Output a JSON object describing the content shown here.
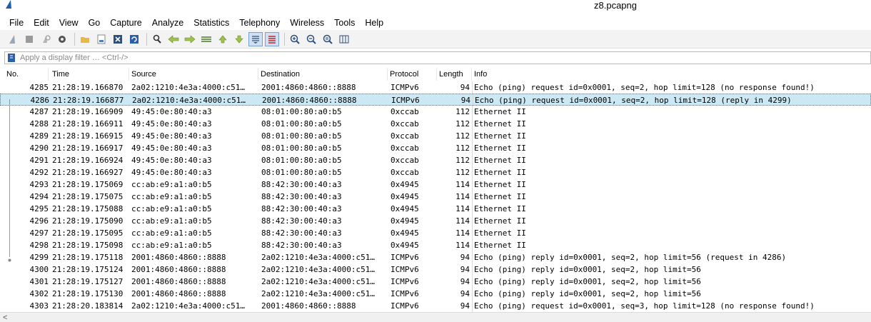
{
  "window": {
    "title": "z8.pcapng"
  },
  "menu": [
    "File",
    "Edit",
    "View",
    "Go",
    "Capture",
    "Analyze",
    "Statistics",
    "Telephony",
    "Wireless",
    "Tools",
    "Help"
  ],
  "toolbar": {
    "icons": [
      "shark-fin-start-icon",
      "stop-icon",
      "restart-icon",
      "options-gear-icon",
      "open-folder-icon",
      "save-file-icon",
      "close-file-icon",
      "reload-icon",
      "find-icon",
      "back-arrow-icon",
      "forward-arrow-icon",
      "goto-packet-icon",
      "first-packet-icon",
      "last-packet-icon",
      "autoscroll-icon",
      "colorize-icon",
      "zoom-in-icon",
      "zoom-out-icon",
      "zoom-normal-icon",
      "resize-columns-icon"
    ]
  },
  "filter": {
    "placeholder": "Apply a display filter … <Ctrl-/>"
  },
  "columns": {
    "no": "No.",
    "time": "Time",
    "source": "Source",
    "destination": "Destination",
    "protocol": "Protocol",
    "length": "Length",
    "info": "Info"
  },
  "packets": [
    {
      "no": "4285",
      "time": "21:28:19.166870",
      "source": "2a02:1210:4e3a:4000:c51…",
      "destination": "2001:4860:4860::8888",
      "protocol": "ICMPv6",
      "length": "94",
      "info": "Echo (ping) request id=0x0001, seq=2, hop limit=128 (no response found!)"
    },
    {
      "no": "4286",
      "time": "21:28:19.166877",
      "source": "2a02:1210:4e3a:4000:c51…",
      "destination": "2001:4860:4860::8888",
      "protocol": "ICMPv6",
      "length": "94",
      "info": "Echo (ping) request id=0x0001, seq=2, hop limit=128 (reply in 4299)",
      "selected": true
    },
    {
      "no": "4287",
      "time": "21:28:19.166909",
      "source": "49:45:0e:80:40:a3",
      "destination": "08:01:00:80:a0:b5",
      "protocol": "0xccab",
      "length": "112",
      "info": "Ethernet II"
    },
    {
      "no": "4288",
      "time": "21:28:19.166911",
      "source": "49:45:0e:80:40:a3",
      "destination": "08:01:00:80:a0:b5",
      "protocol": "0xccab",
      "length": "112",
      "info": "Ethernet II"
    },
    {
      "no": "4289",
      "time": "21:28:19.166915",
      "source": "49:45:0e:80:40:a3",
      "destination": "08:01:00:80:a0:b5",
      "protocol": "0xccab",
      "length": "112",
      "info": "Ethernet II"
    },
    {
      "no": "4290",
      "time": "21:28:19.166917",
      "source": "49:45:0e:80:40:a3",
      "destination": "08:01:00:80:a0:b5",
      "protocol": "0xccab",
      "length": "112",
      "info": "Ethernet II"
    },
    {
      "no": "4291",
      "time": "21:28:19.166924",
      "source": "49:45:0e:80:40:a3",
      "destination": "08:01:00:80:a0:b5",
      "protocol": "0xccab",
      "length": "112",
      "info": "Ethernet II"
    },
    {
      "no": "4292",
      "time": "21:28:19.166927",
      "source": "49:45:0e:80:40:a3",
      "destination": "08:01:00:80:a0:b5",
      "protocol": "0xccab",
      "length": "112",
      "info": "Ethernet II"
    },
    {
      "no": "4293",
      "time": "21:28:19.175069",
      "source": "cc:ab:e9:a1:a0:b5",
      "destination": "88:42:30:00:40:a3",
      "protocol": "0x4945",
      "length": "114",
      "info": "Ethernet II"
    },
    {
      "no": "4294",
      "time": "21:28:19.175075",
      "source": "cc:ab:e9:a1:a0:b5",
      "destination": "88:42:30:00:40:a3",
      "protocol": "0x4945",
      "length": "114",
      "info": "Ethernet II"
    },
    {
      "no": "4295",
      "time": "21:28:19.175088",
      "source": "cc:ab:e9:a1:a0:b5",
      "destination": "88:42:30:00:40:a3",
      "protocol": "0x4945",
      "length": "114",
      "info": "Ethernet II"
    },
    {
      "no": "4296",
      "time": "21:28:19.175090",
      "source": "cc:ab:e9:a1:a0:b5",
      "destination": "88:42:30:00:40:a3",
      "protocol": "0x4945",
      "length": "114",
      "info": "Ethernet II"
    },
    {
      "no": "4297",
      "time": "21:28:19.175095",
      "source": "cc:ab:e9:a1:a0:b5",
      "destination": "88:42:30:00:40:a3",
      "protocol": "0x4945",
      "length": "114",
      "info": "Ethernet II"
    },
    {
      "no": "4298",
      "time": "21:28:19.175098",
      "source": "cc:ab:e9:a1:a0:b5",
      "destination": "88:42:30:00:40:a3",
      "protocol": "0x4945",
      "length": "114",
      "info": "Ethernet II"
    },
    {
      "no": "4299",
      "time": "21:28:19.175118",
      "source": "2001:4860:4860::8888",
      "destination": "2a02:1210:4e3a:4000:c51…",
      "protocol": "ICMPv6",
      "length": "94",
      "info": "Echo (ping) reply id=0x0001, seq=2, hop limit=56 (request in 4286)"
    },
    {
      "no": "4300",
      "time": "21:28:19.175124",
      "source": "2001:4860:4860::8888",
      "destination": "2a02:1210:4e3a:4000:c51…",
      "protocol": "ICMPv6",
      "length": "94",
      "info": "Echo (ping) reply id=0x0001, seq=2, hop limit=56"
    },
    {
      "no": "4301",
      "time": "21:28:19.175127",
      "source": "2001:4860:4860::8888",
      "destination": "2a02:1210:4e3a:4000:c51…",
      "protocol": "ICMPv6",
      "length": "94",
      "info": "Echo (ping) reply id=0x0001, seq=2, hop limit=56"
    },
    {
      "no": "4302",
      "time": "21:28:19.175130",
      "source": "2001:4860:4860::8888",
      "destination": "2a02:1210:4e3a:4000:c51…",
      "protocol": "ICMPv6",
      "length": "94",
      "info": "Echo (ping) reply id=0x0001, seq=2, hop limit=56"
    },
    {
      "no": "4303",
      "time": "21:28:20.183814",
      "source": "2a02:1210:4e3a:4000:c51…",
      "destination": "2001:4860:4860::8888",
      "protocol": "ICMPv6",
      "length": "94",
      "info": "Echo (ping) request id=0x0001, seq=3, hop limit=128 (no response found!)"
    }
  ],
  "scrollbar": {
    "left_arrow": "<"
  },
  "colors": {
    "selected_row": "#cce8f4",
    "selected_border": "#3a7fb0",
    "toolbar_bg": "#f3f3f3"
  }
}
